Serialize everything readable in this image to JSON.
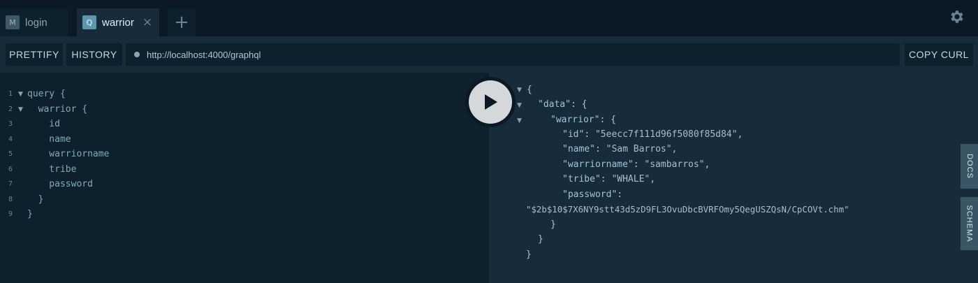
{
  "tabs": [
    {
      "badge": "M",
      "label": "login"
    },
    {
      "badge": "Q",
      "label": "warrior",
      "close": "×"
    }
  ],
  "add_tab_glyph": "+",
  "icons": {
    "settings": "gear-icon",
    "play": "play-icon",
    "close": "close-icon",
    "add": "plus-icon"
  },
  "toolbar": {
    "prettify": "PRETTIFY",
    "history": "HISTORY",
    "url": "http://localhost:4000/graphql",
    "copy_curl": "COPY CURL"
  },
  "editor": {
    "line_numbers": [
      "1",
      "2",
      "3",
      "4",
      "5",
      "6",
      "7",
      "8",
      "9"
    ],
    "lines": [
      "query {",
      "  warrior {",
      "    id",
      "    name",
      "    warriorname",
      "    tribe",
      "    password",
      "  }",
      "}"
    ]
  },
  "result": {
    "open": "{",
    "data_key": "\"data\"",
    "colon": ":",
    "brace_open": "{",
    "warrior_key": "\"warrior\"",
    "id_key": "\"id\"",
    "id_val": "\"5eecc7f111d96f5080f85d84\",",
    "name_key": "\"name\"",
    "name_val": "\"Sam Barros\",",
    "warriorname_key": "\"warriorname\"",
    "warriorname_val": "\"sambarros\",",
    "tribe_key": "\"tribe\"",
    "tribe_val": "\"WHALE\",",
    "password_key": "\"password\"",
    "password_val": "\"$2b$10$7X6NY9stt43d5zD9FL3OvuDbcBVRFOmy5QegUSZQsN/CpCOVt.chm\"",
    "close": "}"
  },
  "side_tabs": {
    "docs": "DOCS",
    "schema": "SCHEMA"
  },
  "colors": {
    "accent": "#5e97ad",
    "background": "#0b1924",
    "panel": "#172b3a",
    "editor": "#0f202d"
  }
}
